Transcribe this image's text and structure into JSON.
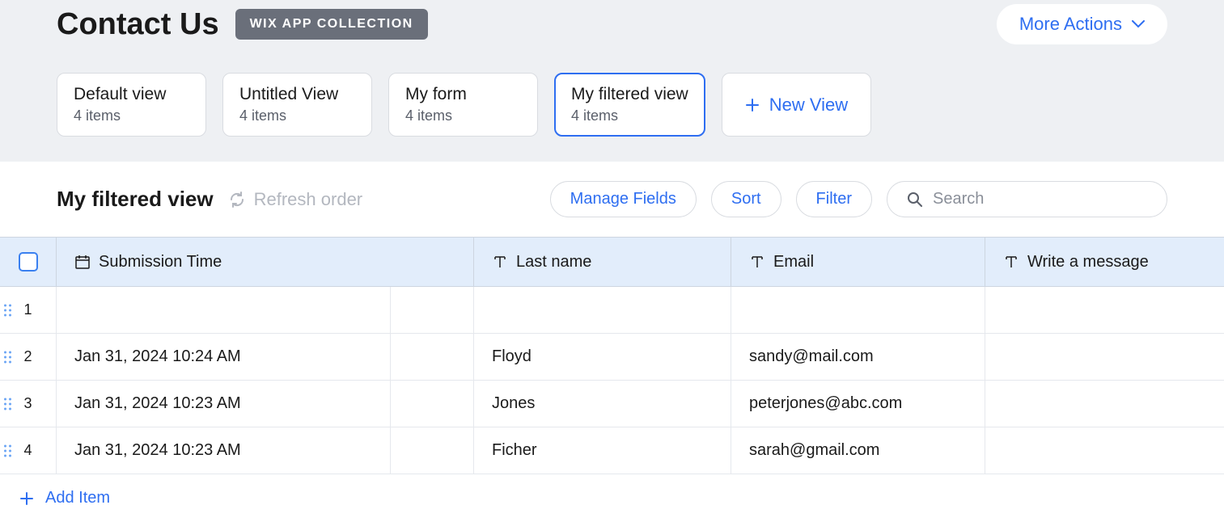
{
  "header": {
    "title": "Contact Us",
    "badge": "WIX APP COLLECTION",
    "more_actions_label": "More Actions"
  },
  "tabs": [
    {
      "label": "Default view",
      "count": "4 items",
      "active": false
    },
    {
      "label": "Untitled View",
      "count": "4 items",
      "active": false
    },
    {
      "label": "My form",
      "count": "4 items",
      "active": false
    },
    {
      "label": "My filtered view",
      "count": "4 items",
      "active": true
    }
  ],
  "new_view_label": "New View",
  "toolbar": {
    "view_name": "My filtered view",
    "refresh_label": "Refresh order",
    "manage_fields_label": "Manage Fields",
    "sort_label": "Sort",
    "filter_label": "Filter",
    "search_placeholder": "Search"
  },
  "columns": {
    "submission": "Submission Time",
    "last": "Last name",
    "email": "Email",
    "message": "Write a message"
  },
  "rows": [
    {
      "num": "1",
      "submission": "",
      "last": "",
      "email": "",
      "message": ""
    },
    {
      "num": "2",
      "submission": "Jan 31, 2024 10:24 AM",
      "last": "Floyd",
      "email": "sandy@mail.com",
      "message": ""
    },
    {
      "num": "3",
      "submission": "Jan 31, 2024 10:23 AM",
      "last": "Jones",
      "email": "peterjones@abc.com",
      "message": ""
    },
    {
      "num": "4",
      "submission": "Jan 31, 2024 10:23 AM",
      "last": "Ficher",
      "email": "sarah@gmail.com",
      "message": ""
    }
  ],
  "add_item_label": "Add Item"
}
